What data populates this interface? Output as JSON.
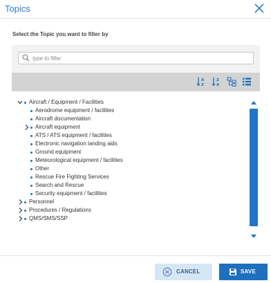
{
  "dialog": {
    "title": "Topics",
    "prompt": "Select the Topic you want to filter by"
  },
  "filter": {
    "placeholder": "type to filter"
  },
  "toolbar": {
    "icons": [
      "sort-alpha-asc-icon",
      "sort-alpha-desc-icon",
      "tree-view-icon",
      "list-view-icon"
    ]
  },
  "tree": {
    "aircraft_group": {
      "label": "Aircraft / Equipment / Facilities",
      "children": [
        "Aerodrome equipment / facilities",
        "Aircraft documentation",
        "Aircraft equipment",
        "ATS / ATS equipment / facilities",
        "Electronic navigation landing aids",
        "Ground equipment",
        "Meteorological equipment / facilities",
        "Other",
        "Rescue Fire Fighting Services",
        "Search and Rescue",
        "Security equipment / facilities"
      ]
    },
    "personnel": "Personnel",
    "procedures": "Procedures / Regulations",
    "qms": "QMS/SMS/SSP"
  },
  "buttons": {
    "cancel": "CANCEL",
    "save": "SAVE"
  },
  "colors": {
    "accent": "#1f6fbf",
    "title": "#2a7fd4",
    "cancel_bg": "#d6e6f5",
    "toolbar_bg": "#d3d3d3",
    "panel_bg": "#f2f2f2"
  }
}
